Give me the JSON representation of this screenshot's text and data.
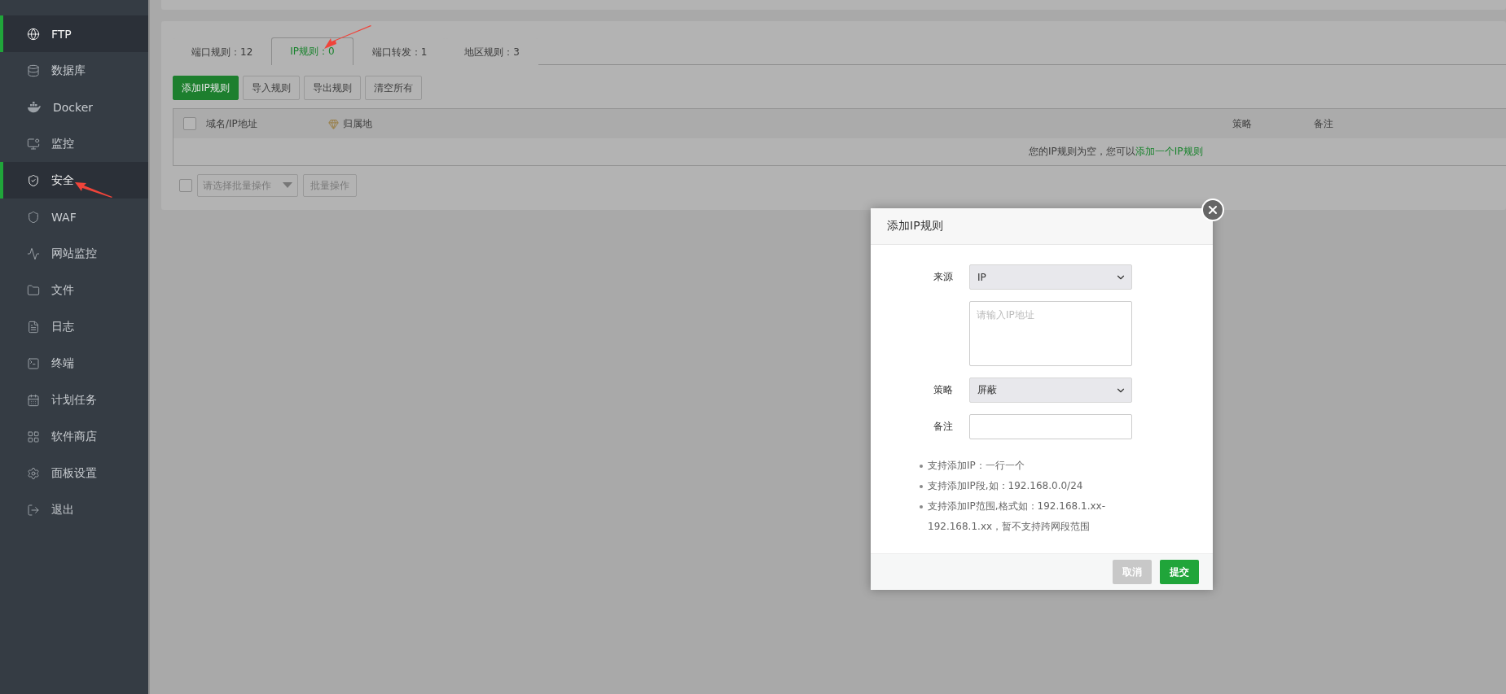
{
  "sidebar": {
    "items": [
      {
        "label": "FTP",
        "selected": true
      },
      {
        "label": "数据库",
        "selected": false
      },
      {
        "label": "Docker",
        "selected": false
      },
      {
        "label": "监控",
        "selected": false
      },
      {
        "label": "安全",
        "selected": true
      },
      {
        "label": "WAF",
        "selected": false
      },
      {
        "label": "网站监控",
        "selected": false
      },
      {
        "label": "文件",
        "selected": false
      },
      {
        "label": "日志",
        "selected": false
      },
      {
        "label": "终端",
        "selected": false
      },
      {
        "label": "计划任务",
        "selected": false
      },
      {
        "label": "软件商店",
        "selected": false
      },
      {
        "label": "面板设置",
        "selected": false
      },
      {
        "label": "退出",
        "selected": false
      }
    ]
  },
  "tabs": [
    {
      "label": "端口规则：12",
      "selected": false
    },
    {
      "label": "IP规则：0",
      "selected": true
    },
    {
      "label": "端口转发：1",
      "selected": false
    },
    {
      "label": "地区规则：3",
      "selected": false
    }
  ],
  "toolbar": {
    "buttons": [
      {
        "label": "添加IP规则",
        "kind": "primary"
      },
      {
        "label": "导入规则",
        "kind": "default"
      },
      {
        "label": "导出规则",
        "kind": "default"
      },
      {
        "label": "清空所有",
        "kind": "default"
      }
    ]
  },
  "table": {
    "header_checked": false,
    "columns": [
      "域名/IP地址",
      "归属地",
      "策略",
      "备注"
    ],
    "empty_text": "您的IP规则为空，您可以",
    "empty_link": "添加一个IP规则"
  },
  "batch": {
    "checked": false,
    "select_placeholder": "请选择批量操作",
    "button": "批量操作"
  },
  "dialog": {
    "title": "添加IP规则",
    "fields": [
      {
        "kind": "select",
        "label": "来源",
        "value": "IP"
      },
      {
        "kind": "textarea",
        "placeholder": "请输入IP地址"
      },
      {
        "kind": "select",
        "label": "策略",
        "value": "屏蔽"
      },
      {
        "kind": "input",
        "label": "备注"
      }
    ],
    "notes": [
      "支持添加IP：一行一个",
      "支持添加IP段,如：192.168.0.0/24",
      "支持添加IP范围,格式如：192.168.1.xx-192.168.1.xx，暂不支持跨网段范围"
    ],
    "buttons": [
      {
        "label": "取消",
        "kind": "disabled"
      },
      {
        "label": "提交",
        "kind": "primary"
      }
    ]
  }
}
